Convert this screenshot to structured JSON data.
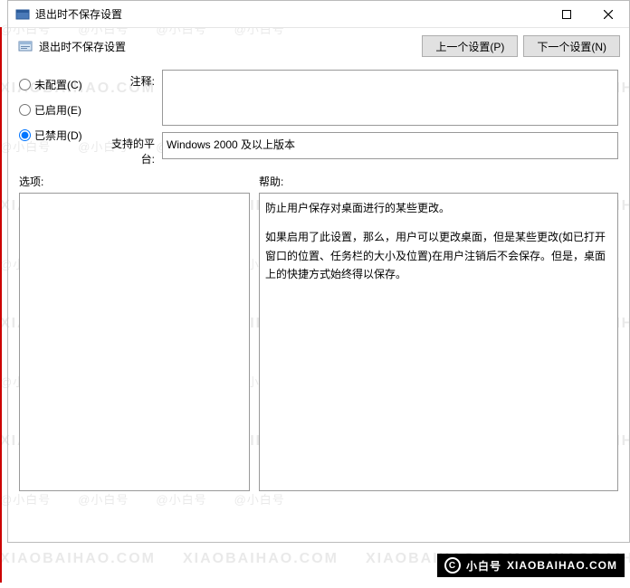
{
  "window": {
    "title": "退出时不保存设置",
    "subtitle": "退出时不保存设置"
  },
  "nav": {
    "prev": "上一个设置(P)",
    "next": "下一个设置(N)"
  },
  "radios": {
    "unconfigured": "未配置(C)",
    "enabled": "已启用(E)",
    "disabled": "已禁用(D)",
    "selected": "disabled"
  },
  "labels": {
    "comment": "注释:",
    "platform": "支持的平台:",
    "options": "选项:",
    "help": "帮助:"
  },
  "fields": {
    "comment": "",
    "platform": "Windows 2000 及以上版本"
  },
  "help": {
    "p1": "防止用户保存对桌面进行的某些更改。",
    "p2": "如果启用了此设置，那么，用户可以更改桌面，但是某些更改(如已打开窗口的位置、任务栏的大小及位置)在用户注销后不会保存。但是，桌面上的快捷方式始终得以保存。"
  },
  "footer": {
    "brand": "小白号",
    "domain": "XIAOBAIHAO.COM"
  },
  "watermark": {
    "a": "@小白号",
    "b": "XIAOBAIHAO.COM"
  }
}
